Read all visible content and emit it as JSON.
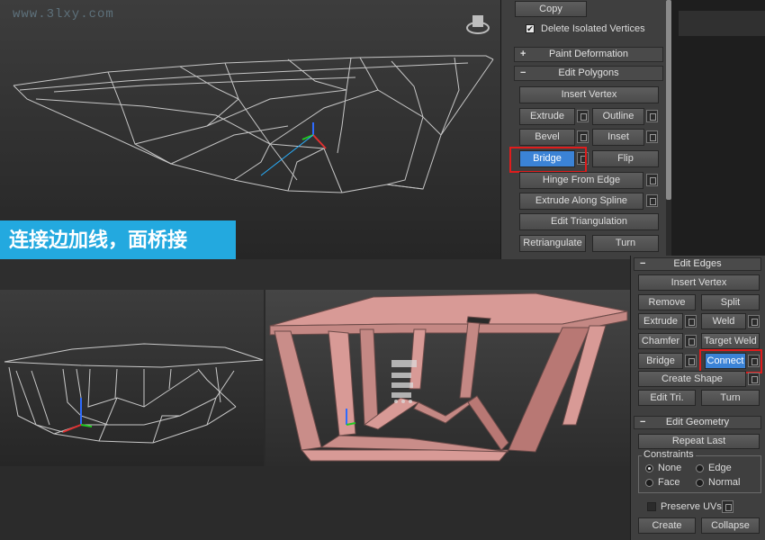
{
  "watermark": "www.3lxy.com",
  "caption": "连接边加线，面桥接",
  "top_panel": {
    "copy_label": "Copy",
    "delete_isolated_label": "Delete Isolated Vertices",
    "delete_isolated_checked": true,
    "paint_deformation": {
      "sign": "+",
      "title": "Paint Deformation"
    },
    "edit_polygons": {
      "sign": "−",
      "title": "Edit Polygons"
    },
    "insert_vertex": "Insert Vertex",
    "extrude": "Extrude",
    "outline": "Outline",
    "bevel": "Bevel",
    "inset": "Inset",
    "bridge": "Bridge",
    "flip": "Flip",
    "hinge_from_edge": "Hinge From Edge",
    "extrude_along_spline": "Extrude Along Spline",
    "edit_triangulation": "Edit Triangulation",
    "retriangulate": "Retriangulate",
    "turn": "Turn"
  },
  "edges_panel": {
    "edit_edges": {
      "sign": "−",
      "title": "Edit Edges"
    },
    "insert_vertex": "Insert Vertex",
    "remove": "Remove",
    "split": "Split",
    "extrude": "Extrude",
    "weld": "Weld",
    "chamfer": "Chamfer",
    "target_weld": "Target Weld",
    "bridge": "Bridge",
    "connect": "Connect",
    "create_shape": "Create Shape",
    "edit_tri": "Edit Tri.",
    "turn": "Turn",
    "edit_geometry": {
      "sign": "−",
      "title": "Edit Geometry"
    },
    "repeat_last": "Repeat Last",
    "constraints_label": "Constraints",
    "constraint_options": [
      "None",
      "Edge",
      "Face",
      "Normal"
    ],
    "constraint_selected": "None",
    "preserve_uvs": "Preserve UVs",
    "create": "Create",
    "collapse": "Collapse"
  },
  "colors": {
    "accent_blue": "#3b83d6",
    "caption_bg": "#23a9df",
    "highlight_red": "#e01c1c",
    "mesh_pink": "#d89a96"
  }
}
